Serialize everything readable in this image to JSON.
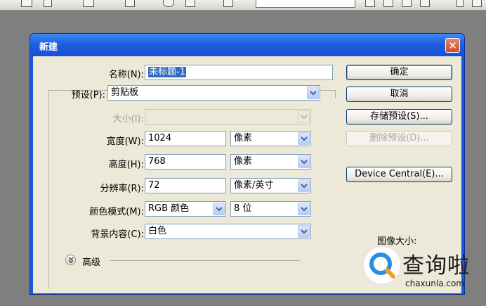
{
  "dialog": {
    "title": "新建",
    "close_glyph": "✕"
  },
  "form": {
    "name_label": "名称(N):",
    "name_value": "未标题-1",
    "preset_label": "预设(P):",
    "preset_value": "剪贴板",
    "size_label": "大小(I):",
    "size_value": "",
    "width_label": "宽度(W):",
    "width_value": "1024",
    "width_unit": "像素",
    "height_label": "高度(H):",
    "height_value": "768",
    "height_unit": "像素",
    "resolution_label": "分辨率(R):",
    "resolution_value": "72",
    "resolution_unit": "像素/英寸",
    "color_mode_label": "颜色模式(M):",
    "color_mode_value": "RGB 颜色",
    "bit_depth_value": "8 位",
    "background_label": "背景内容(C):",
    "background_value": "白色",
    "advanced_label": "高级"
  },
  "buttons": {
    "ok": "确定",
    "cancel": "取消",
    "save_preset": "存储预设(S)...",
    "delete_preset": "删除预设(D)...",
    "device_central": "Device Central(E)..."
  },
  "info": {
    "image_size_label": "图像大小:"
  },
  "watermark": {
    "text": "查询啦",
    "url": "chaxunla.com"
  },
  "colors": {
    "title_bar": "#1e5fe0",
    "client_bg": "#ece9d8",
    "selection": "#316ac5"
  }
}
